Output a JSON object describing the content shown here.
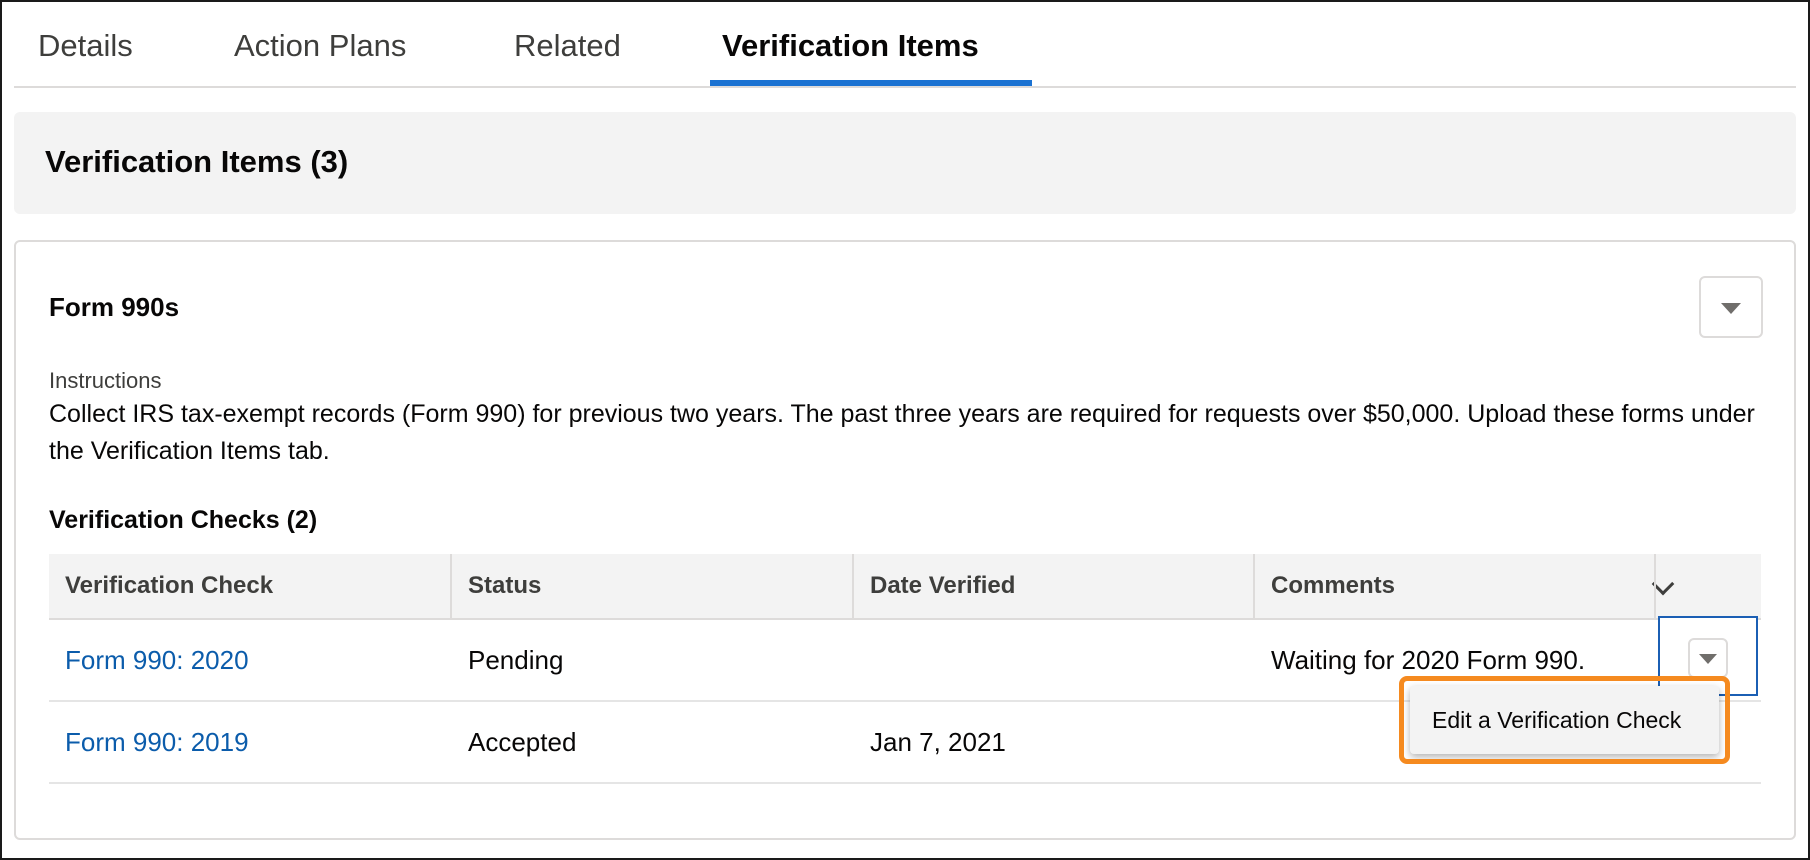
{
  "tabs": [
    {
      "label": "Details"
    },
    {
      "label": "Action Plans"
    },
    {
      "label": "Related"
    },
    {
      "label": "Verification Items",
      "active": true
    }
  ],
  "header": {
    "title": "Verification Items (3)"
  },
  "card": {
    "title": "Form 990s",
    "menu_icon": "chevron-down-icon",
    "instructions_label": "Instructions",
    "instructions_text": "Collect IRS tax-exempt records (Form 990) for previous two years. The past three years are required for requests over $50,000. Upload these forms under the Verification Items tab."
  },
  "checks": {
    "title": "Verification Checks (2)",
    "columns": [
      "Verification Check",
      "Status",
      "Date Verified",
      "Comments"
    ],
    "rows": [
      {
        "check": "Form 990: 2020",
        "status": "Pending",
        "date": "",
        "comments": "Waiting for 2020 Form 990."
      },
      {
        "check": "Form 990: 2019",
        "status": "Accepted",
        "date": "Jan 7, 2021",
        "comments": ""
      }
    ]
  },
  "row_menu": {
    "items": [
      "Edit a Verification Check"
    ]
  },
  "colors": {
    "accent": "#1b72d2",
    "link": "#0b5cab",
    "highlight": "#f58a1f"
  }
}
